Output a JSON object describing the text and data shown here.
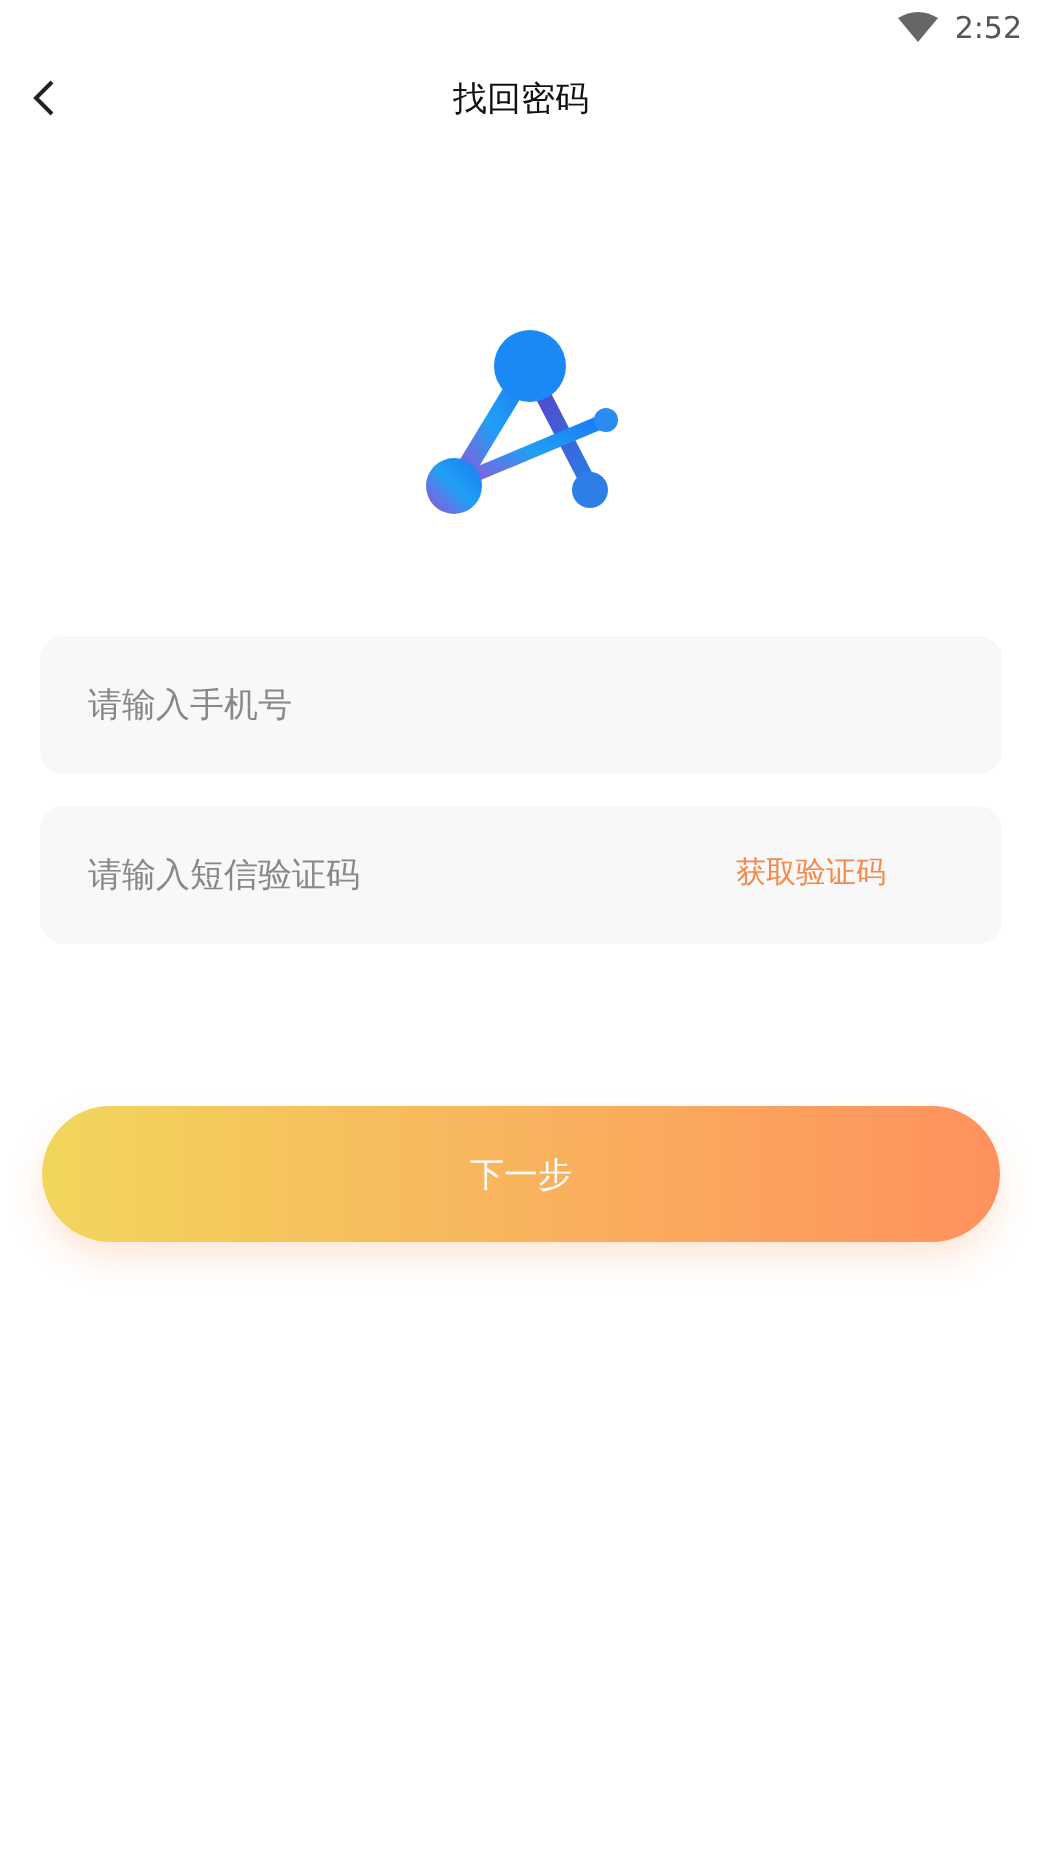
{
  "status_bar": {
    "time": "2:52"
  },
  "header": {
    "title": "找回密码"
  },
  "form": {
    "phone": {
      "placeholder": "请输入手机号"
    },
    "code": {
      "placeholder": "请输入短信验证码",
      "action": "获取验证码"
    }
  },
  "submit": {
    "label": "下一步"
  }
}
